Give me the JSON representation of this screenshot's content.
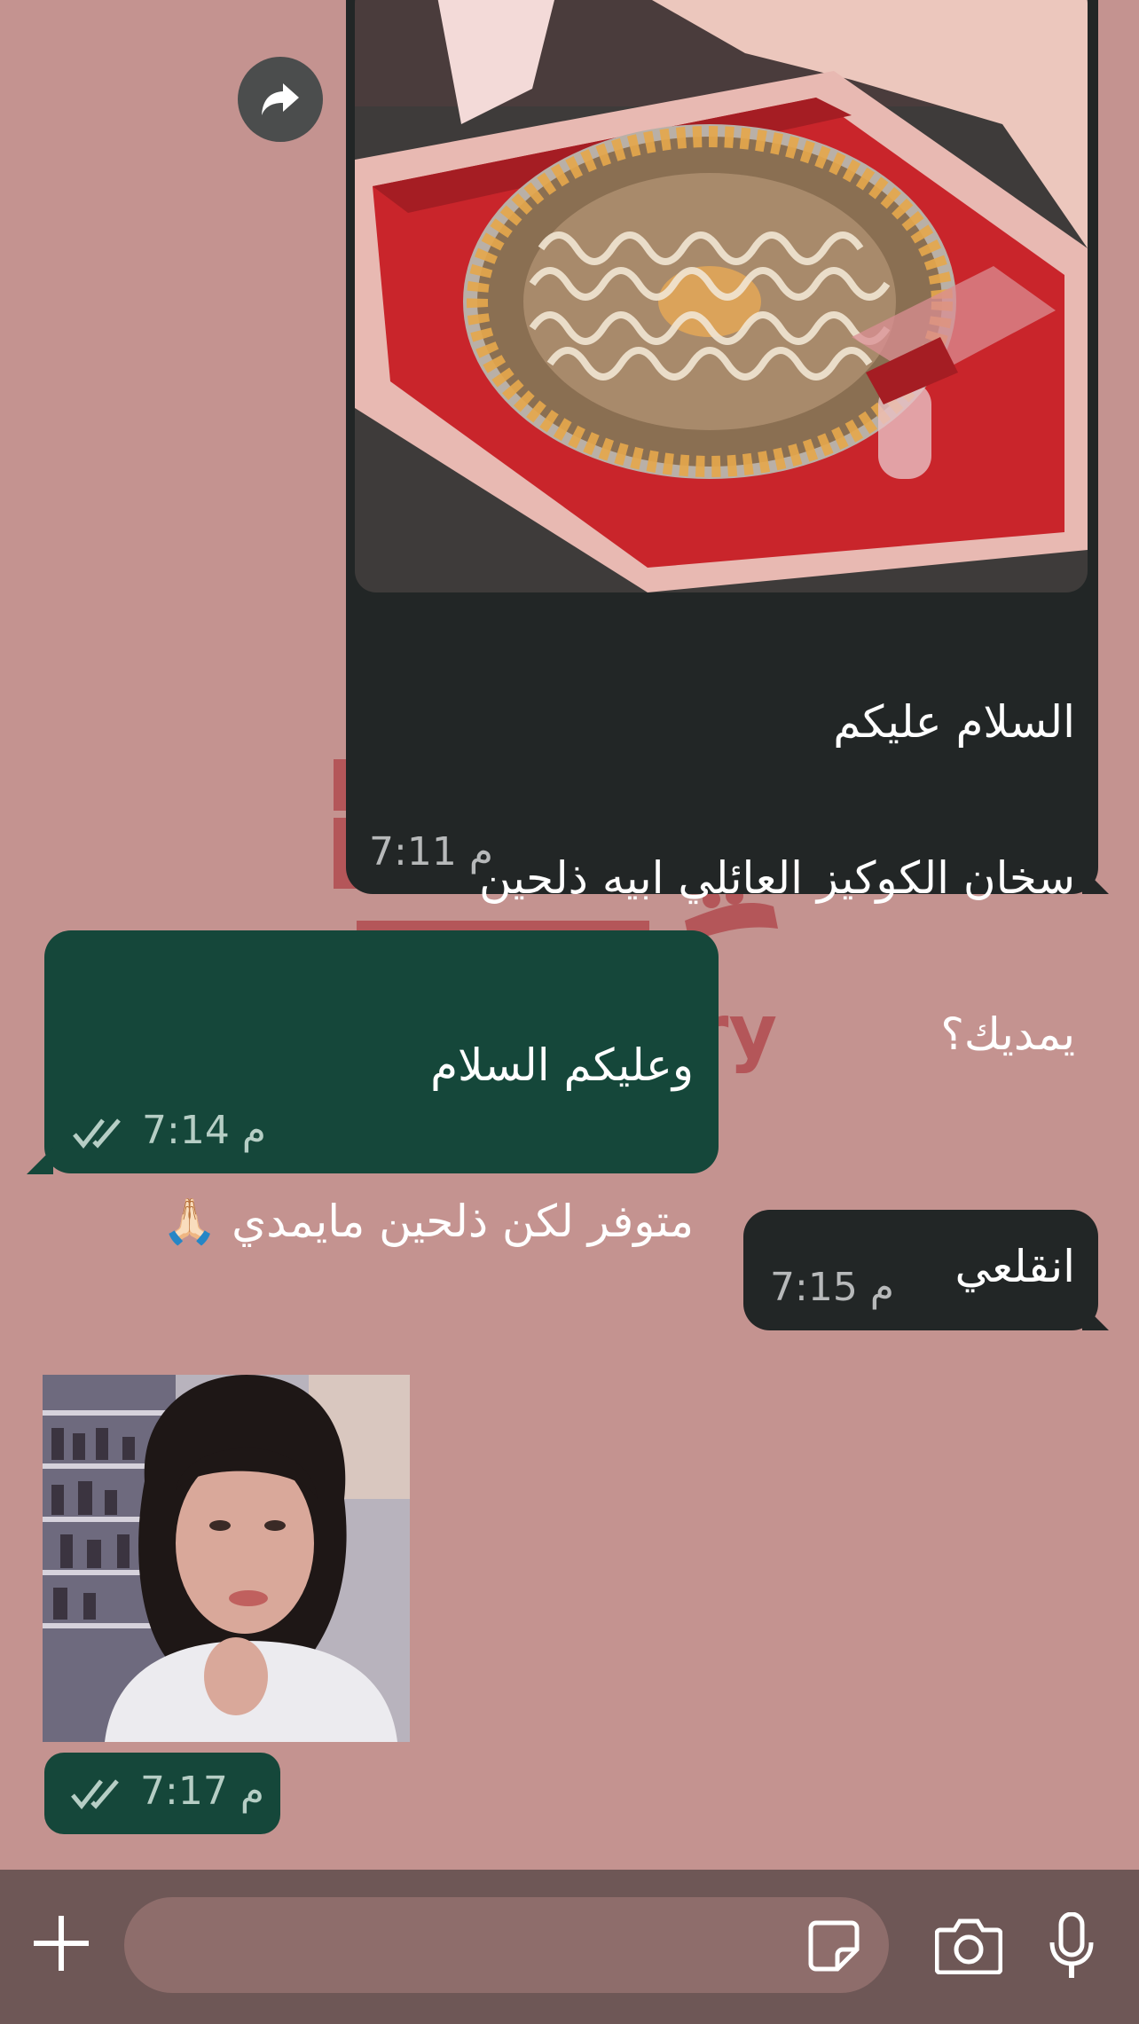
{
  "messages": [
    {
      "id": "incoming-1",
      "direction": "incoming",
      "has_image": true,
      "text_lines": [
        "السلام عليكم",
        "سخان الكوكيز العائلي ابيه ذلحين",
        "يمديك؟"
      ],
      "time": "7:11 م"
    },
    {
      "id": "outgoing-1",
      "direction": "outgoing",
      "text_lines": [
        "وعليكم السلام",
        "متوفر لكن ذلحين مايمدي 🙏🏻"
      ],
      "time": "7:14 م",
      "status": "read"
    },
    {
      "id": "incoming-2",
      "direction": "incoming",
      "text_lines": [
        "انقلعي"
      ],
      "time": "7:15 م"
    },
    {
      "id": "outgoing-2",
      "direction": "outgoing",
      "sticker": true,
      "time": "7:17 م",
      "status": "read"
    }
  ],
  "watermark": {
    "text": "ry"
  },
  "icons": {
    "forward": "forward-arrow-icon",
    "attach": "plus-icon",
    "sticker": "sticker-icon",
    "camera": "camera-icon",
    "mic": "microphone-icon",
    "read_receipt": "double-check-icon"
  },
  "colors": {
    "wallpaper": "#c49390",
    "incoming_bubble": "#222626",
    "outgoing_bubble": "#15473a",
    "input_bar": "#6e5756",
    "input_field": "#8e6d6b"
  }
}
